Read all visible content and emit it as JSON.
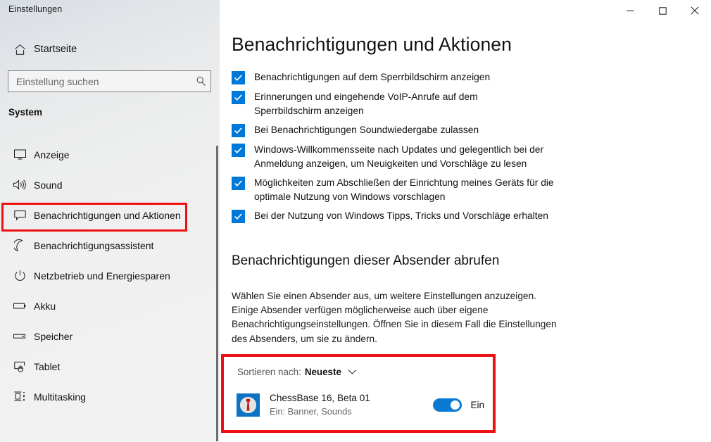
{
  "window": {
    "title": "Einstellungen",
    "controls": {
      "minimize": "minimize-icon",
      "maximize": "maximize-icon",
      "close": "close-icon"
    }
  },
  "sidebar": {
    "home_label": "Startseite",
    "home_icon": "home-icon",
    "search": {
      "placeholder": "Einstellung suchen",
      "value": "",
      "icon": "search-icon"
    },
    "group_label": "System",
    "items": [
      {
        "label": "Anzeige",
        "icon": "monitor-icon",
        "selected": false
      },
      {
        "label": "Sound",
        "icon": "speaker-icon",
        "selected": false
      },
      {
        "label": "Benachrichtigungen und Aktionen",
        "icon": "chat-bubble-icon",
        "selected": true
      },
      {
        "label": "Benachrichtigungsassistent",
        "icon": "moon-icon",
        "selected": false
      },
      {
        "label": "Netzbetrieb und Energiesparen",
        "icon": "power-icon",
        "selected": false
      },
      {
        "label": "Akku",
        "icon": "battery-icon",
        "selected": false
      },
      {
        "label": "Speicher",
        "icon": "storage-drive-icon",
        "selected": false
      },
      {
        "label": "Tablet",
        "icon": "tablet-hand-icon",
        "selected": false
      },
      {
        "label": "Multitasking",
        "icon": "multitasking-icon",
        "selected": false
      }
    ]
  },
  "main": {
    "page_title": "Benachrichtigungen und Aktionen",
    "checkboxes": [
      {
        "label": "Benachrichtigungen auf dem Sperrbildschirm anzeigen",
        "checked": true
      },
      {
        "label": "Erinnerungen und eingehende VoIP-Anrufe auf dem Sperrbildschirm anzeigen",
        "checked": true
      },
      {
        "label": "Bei Benachrichtigungen Soundwiedergabe zulassen",
        "checked": true
      },
      {
        "label": "Windows-Willkommensseite nach Updates und gelegentlich bei der Anmeldung anzeigen, um Neuigkeiten und Vorschläge zu lesen",
        "checked": true
      },
      {
        "label": "Möglichkeiten zum Abschließen der Einrichtung meines Geräts für die optimale Nutzung von Windows vorschlagen",
        "checked": true
      },
      {
        "label": "Bei der Nutzung von Windows Tipps, Tricks und Vorschläge erhalten",
        "checked": true
      }
    ],
    "section": {
      "title": "Benachrichtigungen dieser Absender abrufen",
      "description": "Wählen Sie einen Absender aus, um weitere Einstellungen anzuzeigen. Einige Absender verfügen möglicherweise auch über eigene Benachrichtigungseinstellungen. Öffnen Sie in diesem Fall die Einstellungen des Absenders, um sie zu ändern."
    },
    "sender_list": {
      "sort_label": "Sortieren nach:",
      "sort_value": "Neueste",
      "sort_icon": "chevron-down-icon",
      "senders": [
        {
          "name": "ChessBase 16, Beta 01",
          "subtitle": "Ein: Banner, Sounds",
          "icon": "chessbase-app-icon",
          "toggle_state": "Ein",
          "toggle_on": true
        }
      ]
    }
  },
  "colors": {
    "accent": "#0078d7",
    "highlight_red": "#ee1111",
    "toggle_on": "#0a7bd5",
    "app_icon_bg": "#0b72c4",
    "app_icon_piece": "#c01818"
  }
}
